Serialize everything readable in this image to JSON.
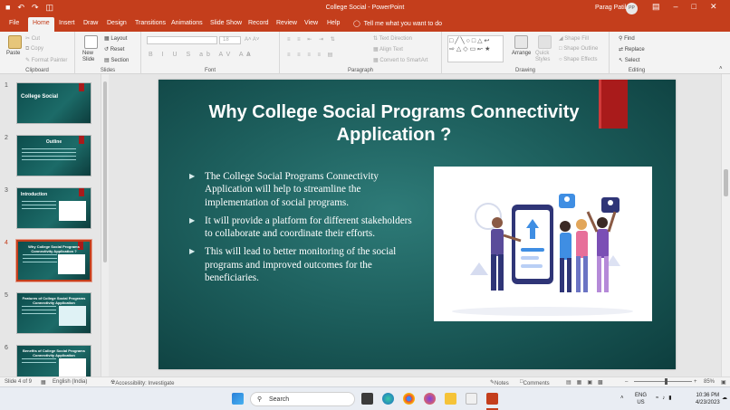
{
  "window": {
    "title": "College Social  -  PowerPoint",
    "user_name": "Parag Patil",
    "user_initials": "PP"
  },
  "ribbon_tabs": [
    "File",
    "Home",
    "Insert",
    "Draw",
    "Design",
    "Transitions",
    "Animations",
    "Slide Show",
    "Record",
    "Review",
    "View",
    "Help"
  ],
  "active_tab": "Home",
  "tell_me": "Tell me what you want to do",
  "ribbon": {
    "clipboard": {
      "paste": "Paste",
      "cut": "Cut",
      "copy": "Copy",
      "format_painter": "Format Painter",
      "label": "Clipboard"
    },
    "slides": {
      "new_slide": "New Slide",
      "layout": "Layout",
      "reset": "Reset",
      "section": "Section",
      "label": "Slides"
    },
    "font": {
      "font_size": "18",
      "label": "Font"
    },
    "paragraph": {
      "text_direction": "Text Direction",
      "align_text": "Align Text",
      "convert_smartart": "Convert to SmartArt",
      "label": "Paragraph"
    },
    "drawing": {
      "arrange": "Arrange",
      "quick_styles": "Quick Styles",
      "shape_fill": "Shape Fill",
      "shape_outline": "Shape Outline",
      "shape_effects": "Shape Effects",
      "label": "Drawing"
    },
    "editing": {
      "find": "Find",
      "replace": "Replace",
      "select": "Select",
      "label": "Editing"
    }
  },
  "thumbnails": [
    {
      "num": "1",
      "title": "College Social"
    },
    {
      "num": "2",
      "title": "Outline"
    },
    {
      "num": "3",
      "title": "Introduction"
    },
    {
      "num": "4",
      "title": "Why College Social Programs Connectivity Application ?"
    },
    {
      "num": "5",
      "title": "Features of College Social Programs Connectivity Application"
    },
    {
      "num": "6",
      "title": "Benefits of College Social Programs Connectivity Application"
    }
  ],
  "selected_slide": 4,
  "slide": {
    "title": "Why College Social Programs Connectivity Application ?",
    "bullets": [
      "The College Social Programs Connectivity Application will help to streamline the implementation of social programs.",
      "It will provide a platform for different stakeholders to collaborate and coordinate their efforts.",
      "This will lead to better monitoring of the social programs and improved outcomes for the beneficiaries."
    ]
  },
  "status_bar": {
    "slide_info": "Slide 4 of 9",
    "language": "English (India)",
    "accessibility": "Accessibility: Investigate",
    "notes": "Notes",
    "comments": "Comments",
    "zoom": "85%"
  },
  "taskbar": {
    "search_label": "Search",
    "lang": "ENG",
    "region": "US",
    "time": "10:36 PM",
    "date": "4/23/2023"
  },
  "colors": {
    "accent": "#c43e1c",
    "slide_bg": "#1c5d5b",
    "bookmark": "#a91b1b"
  }
}
